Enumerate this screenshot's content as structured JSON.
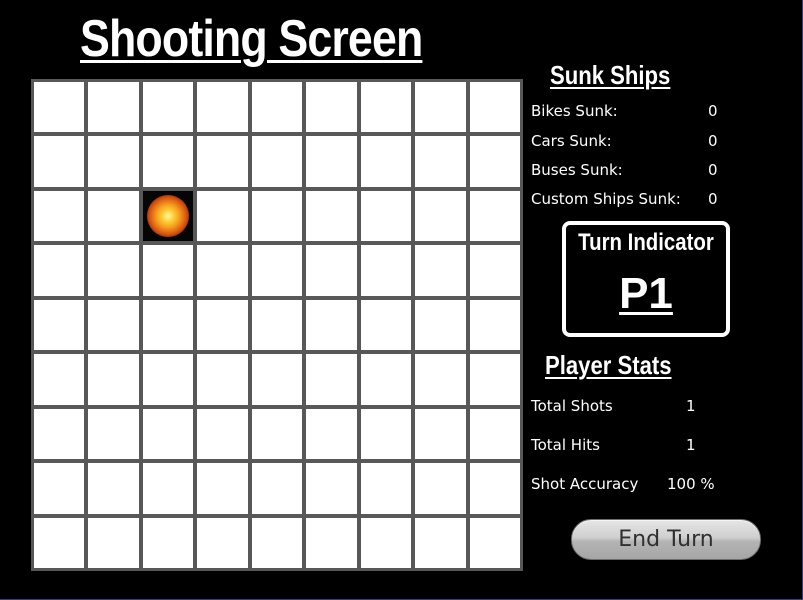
{
  "title": "Shooting Screen",
  "board": {
    "rows": 9,
    "cols": 9,
    "hits": [
      [
        2,
        2
      ]
    ]
  },
  "sunk_ships": {
    "heading": "Sunk Ships",
    "bikes_label": "Bikes Sunk:",
    "bikes_value": "0",
    "cars_label": "Cars Sunk:",
    "cars_value": "0",
    "buses_label": "Buses Sunk:",
    "buses_value": "0",
    "custom_label": "Custom Ships Sunk:",
    "custom_value": "0"
  },
  "turn_indicator": {
    "title": "Turn Indicator",
    "player": "P1"
  },
  "player_stats": {
    "heading": "Player Stats",
    "shots_label": "Total Shots",
    "shots_value": "1",
    "hits_label": "Total Hits",
    "hits_value": "1",
    "accuracy_label": "Shot Accuracy",
    "accuracy_value": "100 %"
  },
  "end_turn_label": "End Turn",
  "icons": {
    "hit": "explosion-icon"
  },
  "colors": {
    "background": "#000000",
    "grid_line": "#585858",
    "cell": "#ffffff",
    "text": "#ffffff"
  }
}
